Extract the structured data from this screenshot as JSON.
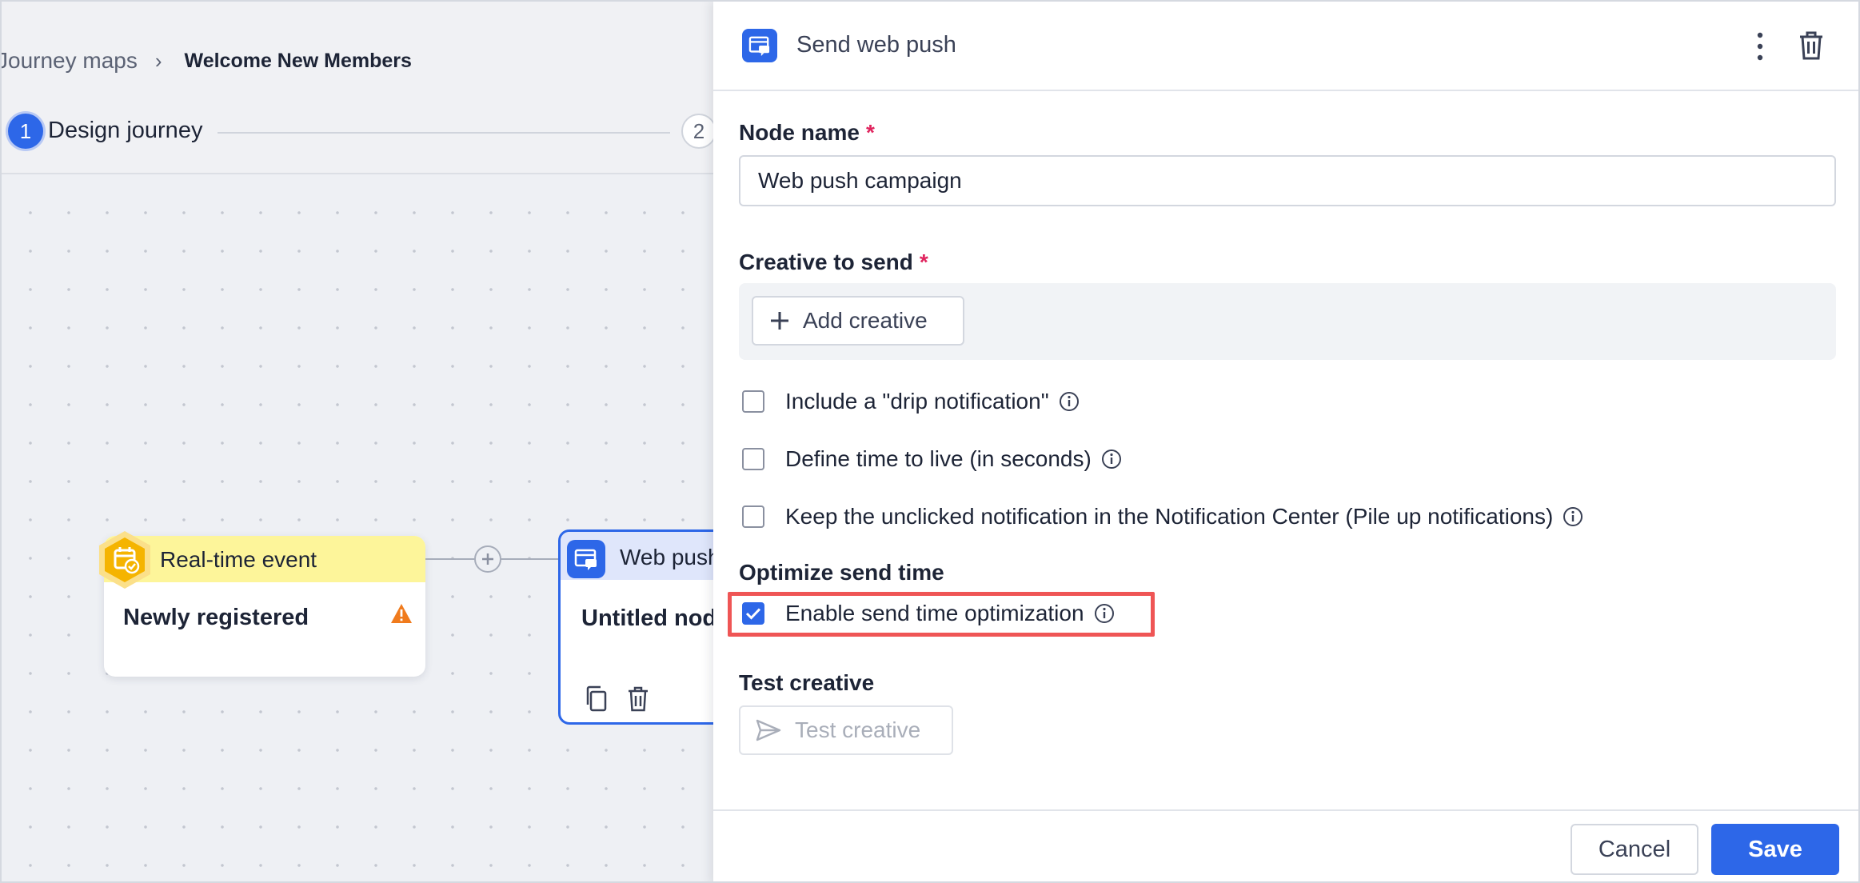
{
  "breadcrumb": {
    "root": "Journey maps",
    "current": "Welcome New Members"
  },
  "steps": [
    {
      "number": "1",
      "label": "Design journey"
    },
    {
      "number": "2"
    }
  ],
  "canvas": {
    "event_node": {
      "header": "Real-time event",
      "title": "Newly registered",
      "icon": "calendar-check-icon",
      "warning_icon": "warning-icon"
    },
    "web_node": {
      "header": "Web push",
      "title": "Untitled node",
      "icon": "web-push-icon"
    }
  },
  "panel": {
    "title": "Send web push",
    "node_name": {
      "label": "Node name",
      "required_mark": "*",
      "value": "Web push campaign"
    },
    "creative": {
      "label": "Creative to send",
      "required_mark": "*",
      "add_label": "Add creative"
    },
    "options": [
      {
        "label": "Include a \"drip notification\"",
        "checked": false
      },
      {
        "label": "Define time to live (in seconds)",
        "checked": false
      },
      {
        "label": "Keep the unclicked notification in the Notification Center (Pile up notifications)",
        "checked": false
      }
    ],
    "optimize": {
      "heading": "Optimize send time",
      "label": "Enable send time optimization",
      "checked": true
    },
    "test": {
      "heading": "Test creative",
      "button_label": "Test creative"
    },
    "footer": {
      "cancel_label": "Cancel",
      "save_label": "Save"
    }
  },
  "colors": {
    "accent": "#2d67e8",
    "event_header": "#fdf59a",
    "event_icon": "#f5b400",
    "warning": "#f07b1d",
    "required": "#e0245e",
    "highlight": "#ef5555"
  }
}
